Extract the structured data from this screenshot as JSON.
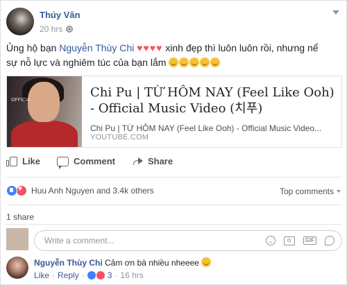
{
  "post": {
    "author": "Thúy Vân",
    "time": "20 hrs",
    "text_prefix": "Ủng hộ bạn ",
    "mention": "Nguyễn Thùy Chi",
    "hearts": "♥♥♥♥",
    "text_mid": " xinh đẹp thì luôn luôn rồi, nhưng nể",
    "text_line2": "sự nỗ lực và nghiêm túc của bạn lắm"
  },
  "link_card": {
    "thumb_text": "OFFICIA",
    "title": "Chi Pu | TỪ HÔM NAY (Feel Like Ooh) - Official Music Video (치푸)",
    "description": "Chi Pu | TỪ HÔM NAY (Feel Like Ooh) - Official Music Video...",
    "domain": "YOUTUBE.COM"
  },
  "actions": {
    "like": "Like",
    "comment": "Comment",
    "share": "Share"
  },
  "reactions": {
    "summary": "Huu Anh Nguyen and 3.4k others",
    "top_comments": "Top comments"
  },
  "shares": "1 share",
  "composer": {
    "placeholder": "Write a comment..."
  },
  "reply": {
    "author": "Nguyễn Thùy Chi",
    "text": " Cảm ơn bà nhiều nheeee",
    "like": "Like",
    "reply": "Reply",
    "reaction_count": "3",
    "time": "16 hrs"
  },
  "colors": {
    "link_blue": "#365899",
    "like_blue": "#4080ff",
    "love_red": "#f25268",
    "muted": "#90949c"
  }
}
